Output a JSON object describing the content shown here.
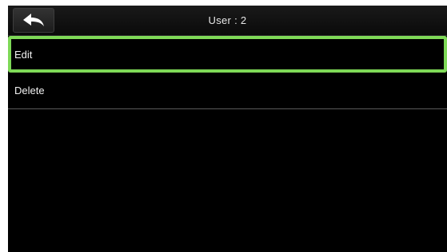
{
  "header": {
    "title": "User : 2",
    "back_icon": "back-arrow-icon"
  },
  "menu": {
    "items": [
      {
        "label": "Edit",
        "selected": true
      },
      {
        "label": "Delete",
        "selected": false
      }
    ]
  },
  "colors": {
    "background": "#000000",
    "selection_border": "#7ed957",
    "text": "#f2f2f2",
    "divider": "#5a5a5a"
  }
}
